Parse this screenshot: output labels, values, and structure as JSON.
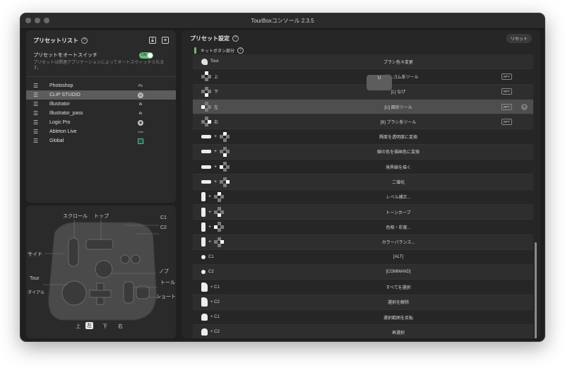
{
  "window": {
    "title": "TourBoxコンソール 2.3.5"
  },
  "left": {
    "title": "プリセットリスト",
    "help": "?",
    "auto_switch": {
      "label": "プリセットをオートスイッチ",
      "description": "プリセットは関連アプリケーションによってオートスウィッチされます。",
      "toggle": "ON",
      "enabled": true
    },
    "presets": [
      {
        "name": "Photoshop",
        "icon": "Ps"
      },
      {
        "name": "CLIP STUDIO",
        "icon": "◎",
        "selected": true
      },
      {
        "name": "Illustrator",
        "icon": "Ai"
      },
      {
        "name": "Illustrator_pass",
        "icon": "Ai"
      },
      {
        "name": "Logic Pro",
        "icon": "◉"
      },
      {
        "name": "Ableton Live",
        "icon": "Live"
      },
      {
        "name": "Global",
        "icon": "⋮⋮"
      }
    ]
  },
  "device": {
    "labels": {
      "scroll": "スクロール",
      "top": "トップ",
      "c1": "C1",
      "c2": "C2",
      "side": "サイド",
      "knob": "ノブ",
      "tour": "Tour",
      "dial": "ダイアル",
      "tall": "トール",
      "short": "ショート",
      "up": "上",
      "left": "左",
      "down": "下",
      "right": "右"
    }
  },
  "right": {
    "title": "プリセット設定",
    "help": "?",
    "reset": "リセット",
    "section": "キットボタン部分",
    "tooltip": "U",
    "rows": [
      {
        "key_icon": "tour",
        "key_text": "Tour",
        "action": "ブラシ色々変更"
      },
      {
        "key_icon": "dpad-up",
        "key_text": "上",
        "action": "[E] 消しゴム系ツール",
        "rpt": "RPT"
      },
      {
        "key_icon": "dpad-down",
        "key_text": "下",
        "action": "[L] なげ",
        "rpt": "RPT"
      },
      {
        "key_icon": "dpad-left",
        "key_text": "左",
        "action": "[U] 図形ツール",
        "rpt": "RPT",
        "highlight": true
      },
      {
        "key_icon": "dpad-right",
        "key_text": "右",
        "action": "[B] ブラシ系ツール",
        "rpt": "RPT"
      },
      {
        "key_icon": "side+dpad-up",
        "action": "輝度を透明度に変換"
      },
      {
        "key_icon": "side+dpad-down",
        "action": "線の色を描画色に変換"
      },
      {
        "key_icon": "side+dpad-left",
        "action": "境界線を描く"
      },
      {
        "key_icon": "side+dpad-right",
        "action": "二値化"
      },
      {
        "key_icon": "top+dpad-up",
        "action": "レベル補正..."
      },
      {
        "key_icon": "top+dpad-down",
        "action": "トーンカーブ"
      },
      {
        "key_icon": "top+dpad-left",
        "action": "色相・彩度..."
      },
      {
        "key_icon": "top+dpad-right",
        "action": "カラーバランス..."
      },
      {
        "key_icon": "c1",
        "key_text": "C1",
        "action": "[ALT]"
      },
      {
        "key_icon": "c2",
        "key_text": "C2",
        "action": "[COMMAND]"
      },
      {
        "key_icon": "tall+c1",
        "key_text": "+ C1",
        "action": "すべてを選択"
      },
      {
        "key_icon": "tall+c2",
        "key_text": "+ C2",
        "action": "選択を解除"
      },
      {
        "key_icon": "short+c1",
        "key_text": "+ C1",
        "action": "選択範囲を反転"
      },
      {
        "key_icon": "short+c2",
        "key_text": "+ C2",
        "action": "再選択"
      }
    ]
  }
}
